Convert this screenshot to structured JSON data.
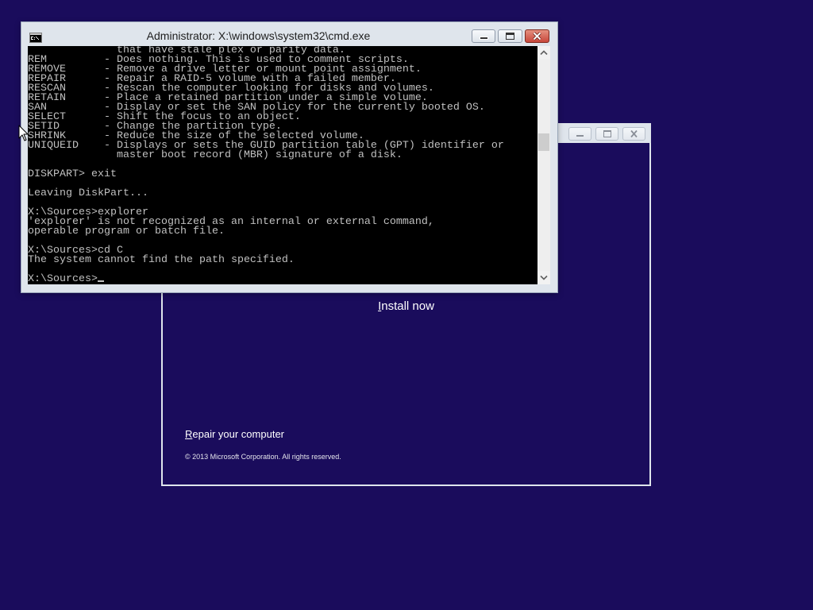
{
  "colors": {
    "desktop_background": "#1a0c5c",
    "window_frame": "#dfe5ec",
    "console_background": "#000000",
    "console_text": "#c0c0c0",
    "close_button": "#c8473b",
    "setup_text": "#ffffff"
  },
  "icons": {
    "cmd_window_icon": "command-prompt-icon",
    "minimize": "minimize-icon",
    "maximize": "maximize-icon",
    "close": "close-icon",
    "scroll_up": "chevron-up-icon",
    "scroll_down": "chevron-down-icon",
    "pointer": "mouse-pointer-icon"
  },
  "setup_window": {
    "install_now": "Install now",
    "repair_computer": "Repair your computer",
    "copyright": "© 2013 Microsoft Corporation. All rights reserved."
  },
  "cmd_window": {
    "title": "Administrator: X:\\windows\\system32\\cmd.exe",
    "console": {
      "lines": [
        "              that have stale plex or parity data.",
        "REM         - Does nothing. This is used to comment scripts.",
        "REMOVE      - Remove a drive letter or mount point assignment.",
        "REPAIR      - Repair a RAID-5 volume with a failed member.",
        "RESCAN      - Rescan the computer looking for disks and volumes.",
        "RETAIN      - Place a retained partition under a simple volume.",
        "SAN         - Display or set the SAN policy for the currently booted OS.",
        "SELECT      - Shift the focus to an object.",
        "SETID       - Change the partition type.",
        "SHRINK      - Reduce the size of the selected volume.",
        "UNIQUEID    - Displays or sets the GUID partition table (GPT) identifier or",
        "              master boot record (MBR) signature of a disk.",
        "",
        "DISKPART> exit",
        "",
        "Leaving DiskPart...",
        "",
        "X:\\Sources>explorer",
        "'explorer' is not recognized as an internal or external command,",
        "operable program or batch file.",
        "",
        "X:\\Sources>cd C",
        "The system cannot find the path specified.",
        ""
      ],
      "prompt": "X:\\Sources>"
    },
    "scrollbar": {
      "scroll_position": 0.38
    }
  }
}
